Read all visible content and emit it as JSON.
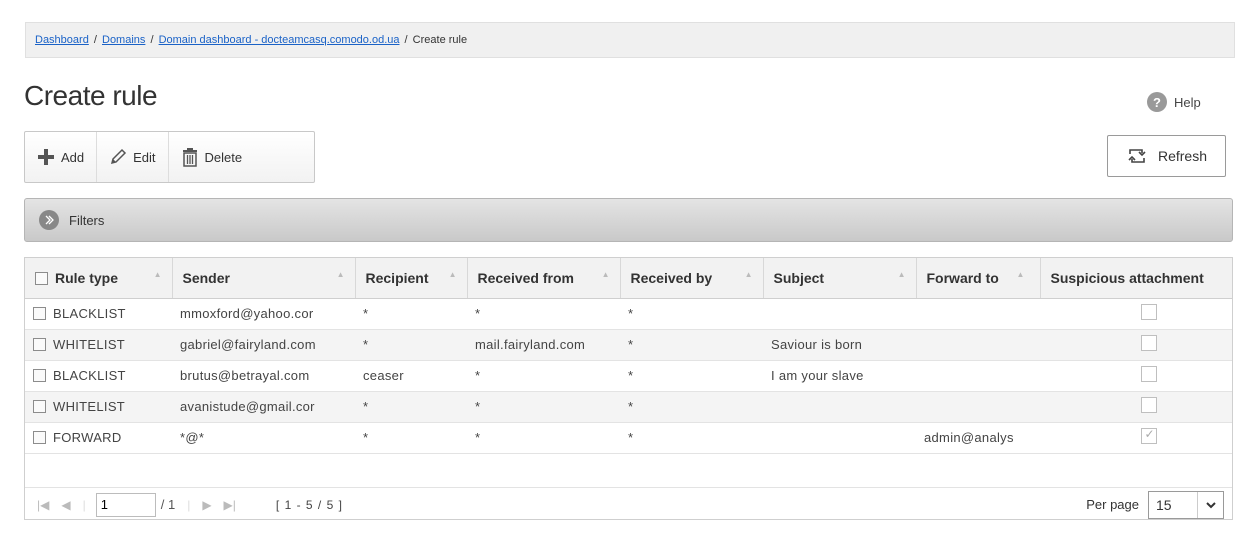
{
  "breadcrumb": {
    "items": [
      "Dashboard",
      "Domains",
      "Domain dashboard - docteamcasq.comodo.od.ua"
    ],
    "current": "Create rule"
  },
  "page": {
    "title": "Create rule",
    "help_label": "Help"
  },
  "toolbar": {
    "add_label": "Add",
    "edit_label": "Edit",
    "delete_label": "Delete",
    "refresh_label": "Refresh"
  },
  "filters": {
    "label": "Filters"
  },
  "table": {
    "headers": [
      "Rule type",
      "Sender",
      "Recipient",
      "Received from",
      "Received by",
      "Subject",
      "Forward to",
      "Suspicious attachment"
    ],
    "rows": [
      {
        "rule_type": "BLACKLIST",
        "sender": "mmoxford@yahoo.cor",
        "recipient": "*",
        "received_from": "*",
        "received_by": "*",
        "subject": "",
        "forward_to": "",
        "suspicious": false
      },
      {
        "rule_type": "WHITELIST",
        "sender": "gabriel@fairyland.com",
        "recipient": "*",
        "received_from": "mail.fairyland.com",
        "received_by": "*",
        "subject": "Saviour is born",
        "forward_to": "",
        "suspicious": false
      },
      {
        "rule_type": "BLACKLIST",
        "sender": "brutus@betrayal.com",
        "recipient": "ceaser",
        "received_from": "*",
        "received_by": "*",
        "subject": "I am your slave",
        "forward_to": "",
        "suspicious": false
      },
      {
        "rule_type": "WHITELIST",
        "sender": "avanistude@gmail.cor",
        "recipient": "*",
        "received_from": "*",
        "received_by": "*",
        "subject": "",
        "forward_to": "",
        "suspicious": false
      },
      {
        "rule_type": "FORWARD",
        "sender": "*@*",
        "recipient": "*",
        "received_from": "*",
        "received_by": "*",
        "subject": "",
        "forward_to": "admin@analys",
        "suspicious": true
      }
    ]
  },
  "pager": {
    "page": "1",
    "total": "/ 1",
    "range": "[ 1 - 5 / 5 ]",
    "per_page_label": "Per page",
    "per_page_value": "15"
  },
  "colors": {
    "link": "#1a62c7",
    "header_bg": "#f2f2f2",
    "filter_bar": "#c9c9c9"
  }
}
